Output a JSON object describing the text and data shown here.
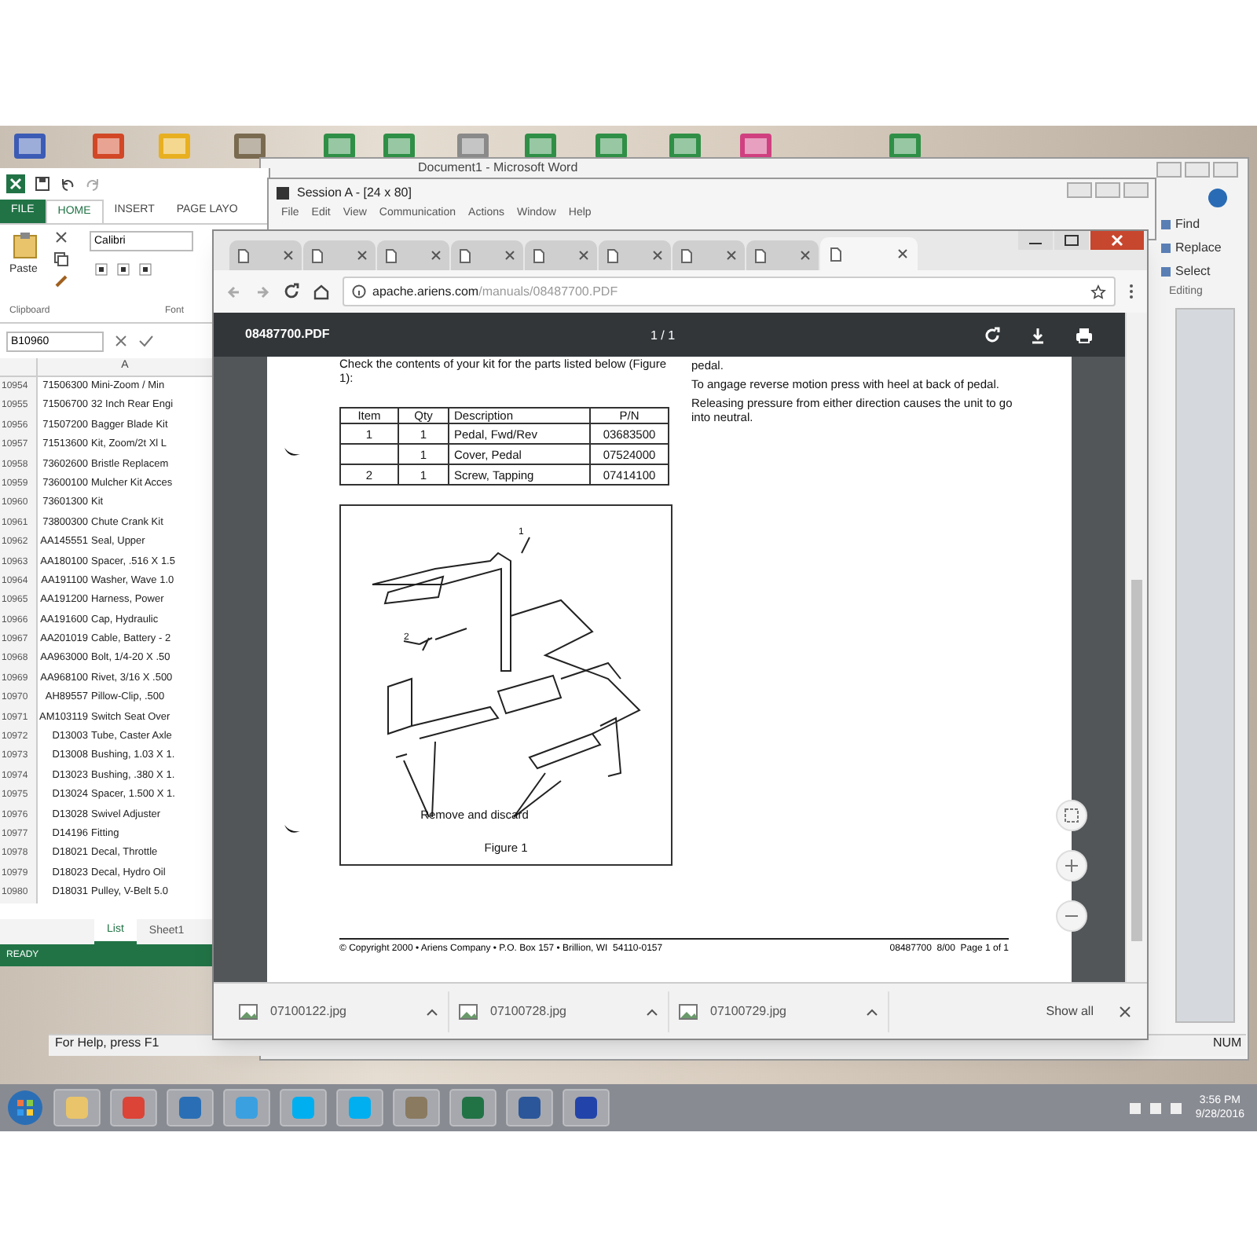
{
  "excel": {
    "ribbon_tabs": [
      {
        "label": "FILE",
        "kind": "backstage",
        "selected": false
      },
      {
        "label": "HOME",
        "kind": "tab",
        "selected": true
      },
      {
        "label": "INSERT",
        "kind": "tab",
        "selected": false
      },
      {
        "label": "PAGE LAYO",
        "kind": "tab",
        "selected": false
      }
    ],
    "paste_label": "Paste",
    "font_name": "Calibri",
    "group_labels": [
      "Clipboard",
      "Font"
    ],
    "name_box": "B10960",
    "column_header": "A",
    "rows": [
      {
        "num": "10954",
        "code": "71506300",
        "description": "Mini-Zoom / Min"
      },
      {
        "num": "10955",
        "code": "71506700",
        "description": "32 Inch Rear Engi"
      },
      {
        "num": "10956",
        "code": "71507200",
        "description": "Bagger Blade Kit"
      },
      {
        "num": "10957",
        "code": "71513600",
        "description": "Kit, Zoom/2t Xl L"
      },
      {
        "num": "10958",
        "code": "73602600",
        "description": "Bristle Replacem"
      },
      {
        "num": "10959",
        "code": "73600100",
        "description": "Mulcher Kit Acces"
      },
      {
        "num": "10960",
        "code": "73601300",
        "description": "Kit"
      },
      {
        "num": "10961",
        "code": "73800300",
        "description": "Chute Crank Kit"
      },
      {
        "num": "10962",
        "code": "AA145551",
        "description": "Seal, Upper"
      },
      {
        "num": "10963",
        "code": "AA180100",
        "description": "Spacer, .516 X 1.5"
      },
      {
        "num": "10964",
        "code": "AA191100",
        "description": "Washer, Wave 1.0"
      },
      {
        "num": "10965",
        "code": "AA191200",
        "description": "Harness, Power"
      },
      {
        "num": "10966",
        "code": "AA191600",
        "description": "Cap, Hydraulic"
      },
      {
        "num": "10967",
        "code": "AA201019",
        "description": "Cable, Battery - 2"
      },
      {
        "num": "10968",
        "code": "AA963000",
        "description": "Bolt, 1/4-20 X .50"
      },
      {
        "num": "10969",
        "code": "AA968100",
        "description": "Rivet, 3/16 X .500"
      },
      {
        "num": "10970",
        "code": "AH89557",
        "description": "Pillow-Clip, .500"
      },
      {
        "num": "10971",
        "code": "AM103119",
        "description": "Switch Seat Over"
      },
      {
        "num": "10972",
        "code": "D13003",
        "description": "Tube, Caster Axle"
      },
      {
        "num": "10973",
        "code": "D13008",
        "description": "Bushing, 1.03 X 1."
      },
      {
        "num": "10974",
        "code": "D13023",
        "description": "Bushing, .380 X 1."
      },
      {
        "num": "10975",
        "code": "D13024",
        "description": "Spacer, 1.500 X 1."
      },
      {
        "num": "10976",
        "code": "D13028",
        "description": "Swivel Adjuster"
      },
      {
        "num": "10977",
        "code": "D14196",
        "description": "Fitting"
      },
      {
        "num": "10978",
        "code": "D18021",
        "description": "Decal, Throttle"
      },
      {
        "num": "10979",
        "code": "D18023",
        "description": "Decal, Hydro Oil"
      },
      {
        "num": "10980",
        "code": "D18031",
        "description": "Pulley, V-Belt 5.0"
      }
    ],
    "sheet_tabs": [
      {
        "label": "List",
        "selected": true
      },
      {
        "label": "Sheet1",
        "selected": false
      }
    ],
    "status": "READY"
  },
  "word": {
    "title": "Document1 - Microsoft Word",
    "editing_commands": [
      "Find",
      "Replace",
      "Select"
    ],
    "group_label": "Editing",
    "status": "For Help, press F1",
    "indicator": "NUM"
  },
  "terminal": {
    "title": "Session A - [24 x 80]",
    "menu": [
      "File",
      "Edit",
      "View",
      "Communication",
      "Actions",
      "Window",
      "Help"
    ]
  },
  "browser": {
    "tabs": [
      {
        "selected": false
      },
      {
        "selected": false
      },
      {
        "selected": false
      },
      {
        "selected": false
      },
      {
        "selected": false
      },
      {
        "selected": false
      },
      {
        "selected": false
      },
      {
        "selected": false
      },
      {
        "selected": true
      }
    ],
    "url_host": "apache.ariens.com",
    "url_path": "/manuals/08487700.PDF",
    "pdf": {
      "filename": "08487700.PDF",
      "page_indicator": "1 / 1",
      "intro": "Check the contents of your kit for the parts listed below (Figure 1):",
      "table": {
        "columns": [
          "Item",
          "Qty",
          "Description",
          "P/N"
        ],
        "rows": [
          {
            "item": "1",
            "qty": "1",
            "description": "Pedal, Fwd/Rev",
            "pn": "03683500"
          },
          {
            "qty": "1",
            "description": "Cover, Pedal",
            "pn": "07524000"
          },
          {
            "item": "2",
            "qty": "1",
            "description": "Screw, Tapping",
            "pn": "07414100"
          }
        ]
      },
      "figure": {
        "callouts": [
          "1",
          "2"
        ],
        "note": "Remove and discard",
        "caption": "Figure 1"
      },
      "right_paragraphs": [
        "pedal.",
        "To angage reverse motion press with heel at back of pedal.",
        "Releasing pressure from either direction causes the unit to go into neutral."
      ],
      "footer_left": "© Copyright 2000 • Ariens Company • P.O. Box 157 • Brillion, WI  54110-0157",
      "footer_right": "08487700  8/00  Page 1 of 1"
    },
    "downloads": [
      "07100122.jpg",
      "07100728.jpg",
      "07100729.jpg"
    ],
    "show_all": "Show all"
  },
  "taskbar": {
    "time": "3:56 PM",
    "date": "9/28/2016"
  }
}
